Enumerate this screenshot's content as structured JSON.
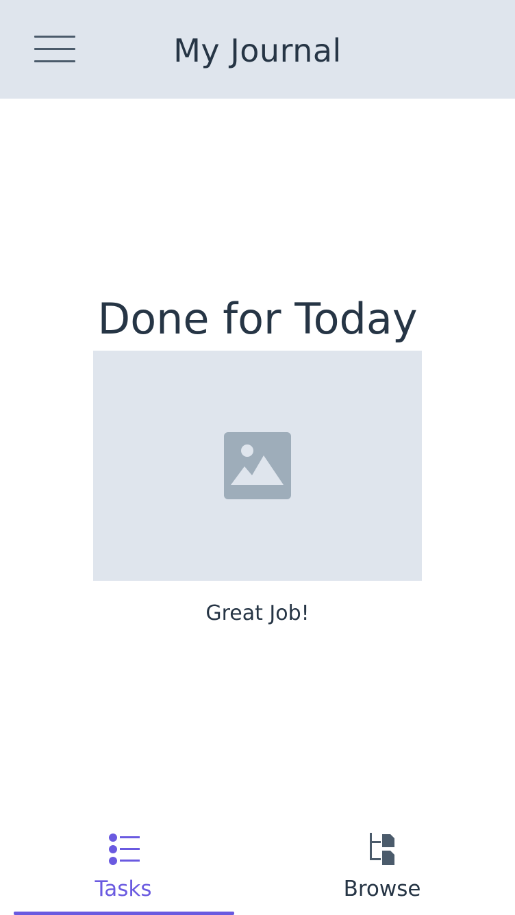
{
  "header": {
    "title": "My Journal",
    "menu_icon": "hamburger-menu-icon"
  },
  "main": {
    "heading": "Done for Today",
    "image_icon": "image-placeholder-icon",
    "caption": "Great Job!"
  },
  "tabs": [
    {
      "label": "Tasks",
      "icon": "task-list-icon",
      "selected": true
    },
    {
      "label": "Browse",
      "icon": "browse-tree-icon",
      "selected": false
    }
  ],
  "colors": {
    "header_bg": "#dfe5ed",
    "text": "#263545",
    "accent": "#6a5ae0",
    "placeholder_bg": "#dfe5ed",
    "placeholder_icon": "#9eadba"
  }
}
